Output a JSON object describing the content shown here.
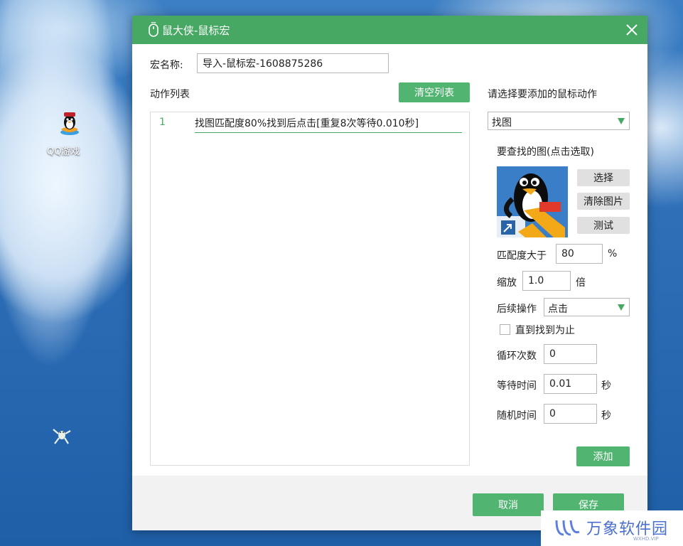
{
  "desktop": {
    "icon_label": "QQ游戏"
  },
  "dialog": {
    "title": "鼠大侠-鼠标宏",
    "macro_name_label": "宏名称:",
    "macro_name_value": "导入-鼠标宏-1608875286",
    "actions_label": "动作列表",
    "clear_list_button": "清空列表",
    "actions": [
      {
        "num": "1",
        "text": "找图匹配度80%找到后点击[重复8次等待0.010秒]"
      }
    ],
    "choose_action_label": "请选择要添加的鼠标动作",
    "action_type_value": "找图",
    "find_image_label": "要查找的图(点击选取)",
    "select_button": "选择",
    "clear_image_button": "清除图片",
    "test_button": "测试",
    "match_label": "匹配度大于",
    "match_value": "80",
    "match_unit": "%",
    "scale_label": "缩放",
    "scale_value": "1.0",
    "scale_unit": "倍",
    "follow_label": "后续操作",
    "follow_value": "点击",
    "until_found_label": "直到找到为止",
    "loop_label": "循环次数",
    "loop_value": "0",
    "wait_label": "等待时间",
    "wait_value": "0.01",
    "wait_unit": "秒",
    "random_label": "随机时间",
    "random_value": "0",
    "random_unit": "秒",
    "add_button": "添加",
    "cancel_button": "取消",
    "save_button": "保存"
  },
  "watermark": {
    "text": "万象软件园",
    "sub": "WXHD.VIP"
  },
  "colors": {
    "accent": "#47a864",
    "button_green": "#51b571"
  }
}
